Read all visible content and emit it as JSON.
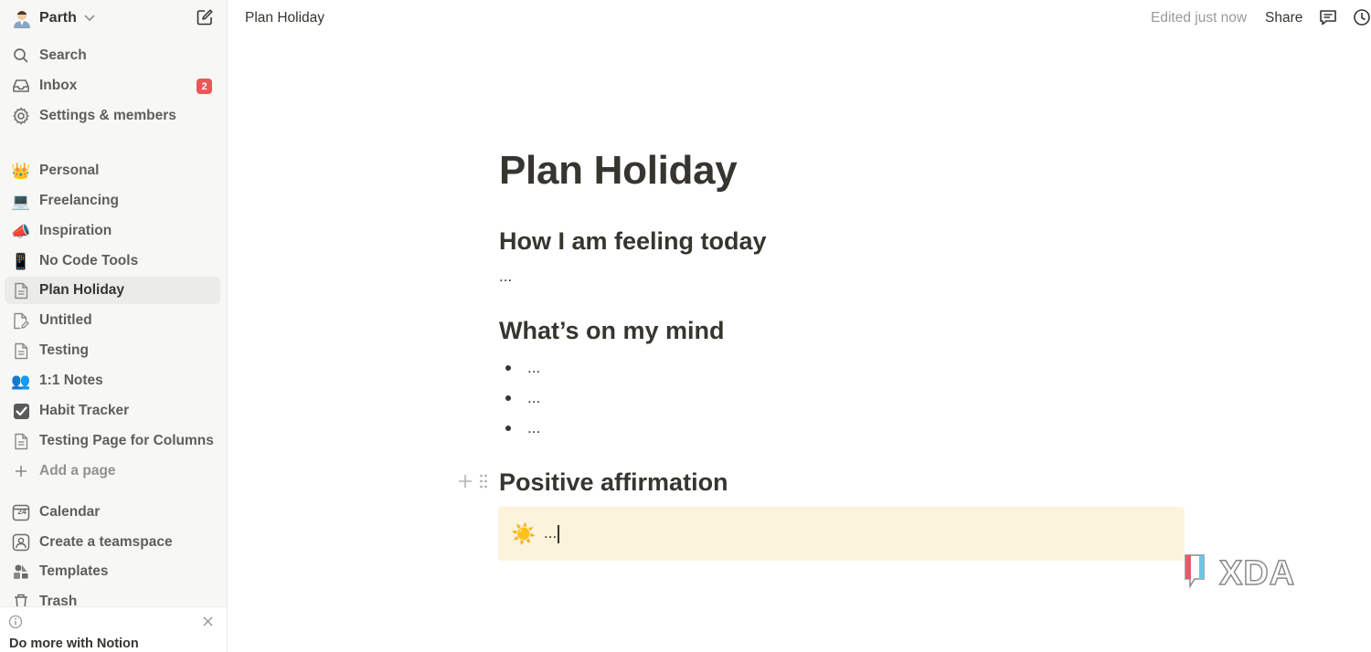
{
  "sidebar": {
    "workspace": {
      "name": "Parth",
      "avatar": "🧑‍💼"
    },
    "top_items": [
      {
        "label": "Search"
      },
      {
        "label": "Inbox",
        "badge": "2"
      },
      {
        "label": "Settings & members"
      }
    ],
    "pages": [
      {
        "label": "Personal",
        "icon": "👑"
      },
      {
        "label": "Freelancing",
        "icon": "💻"
      },
      {
        "label": "Inspiration",
        "icon": "📣"
      },
      {
        "label": "No Code Tools",
        "icon": "📱"
      },
      {
        "label": "Plan Holiday",
        "icon": "page-icon",
        "active": true
      },
      {
        "label": "Untitled",
        "icon": "page-edit-icon"
      },
      {
        "label": "Testing",
        "icon": "page-icon"
      },
      {
        "label": "1:1 Notes",
        "icon": "👥"
      },
      {
        "label": "Habit Tracker",
        "icon": "✅"
      },
      {
        "label": "Testing Page for Columns",
        "icon": "page-icon"
      },
      {
        "label": "Add a page",
        "icon": "plus-icon"
      }
    ],
    "bottom_items": [
      {
        "label": "Calendar",
        "icon": "calendar-icon",
        "date": "24"
      },
      {
        "label": "Create a teamspace",
        "icon": "teamspace-icon"
      },
      {
        "label": "Templates",
        "icon": "templates-icon"
      },
      {
        "label": "Trash",
        "icon": "trash-icon"
      }
    ],
    "promo": {
      "title": "Do more with Notion"
    }
  },
  "topbar": {
    "breadcrumb": "Plan Holiday",
    "edited": "Edited just now",
    "share": "Share"
  },
  "page": {
    "title": "Plan Holiday",
    "sections": [
      {
        "heading": "How I am feeling today",
        "body": "..."
      },
      {
        "heading": "What’s on my mind",
        "bullets": [
          "...",
          "...",
          "..."
        ]
      },
      {
        "heading": "Positive affirmation",
        "callout": {
          "icon": "☀️",
          "text": "..."
        }
      }
    ]
  },
  "watermark": {
    "text": "XDA"
  },
  "colors": {
    "sidebar_bg": "#f7f7f5",
    "callout_bg": "#fbf3db",
    "badge": "#eb5757",
    "text": "#37352f"
  }
}
